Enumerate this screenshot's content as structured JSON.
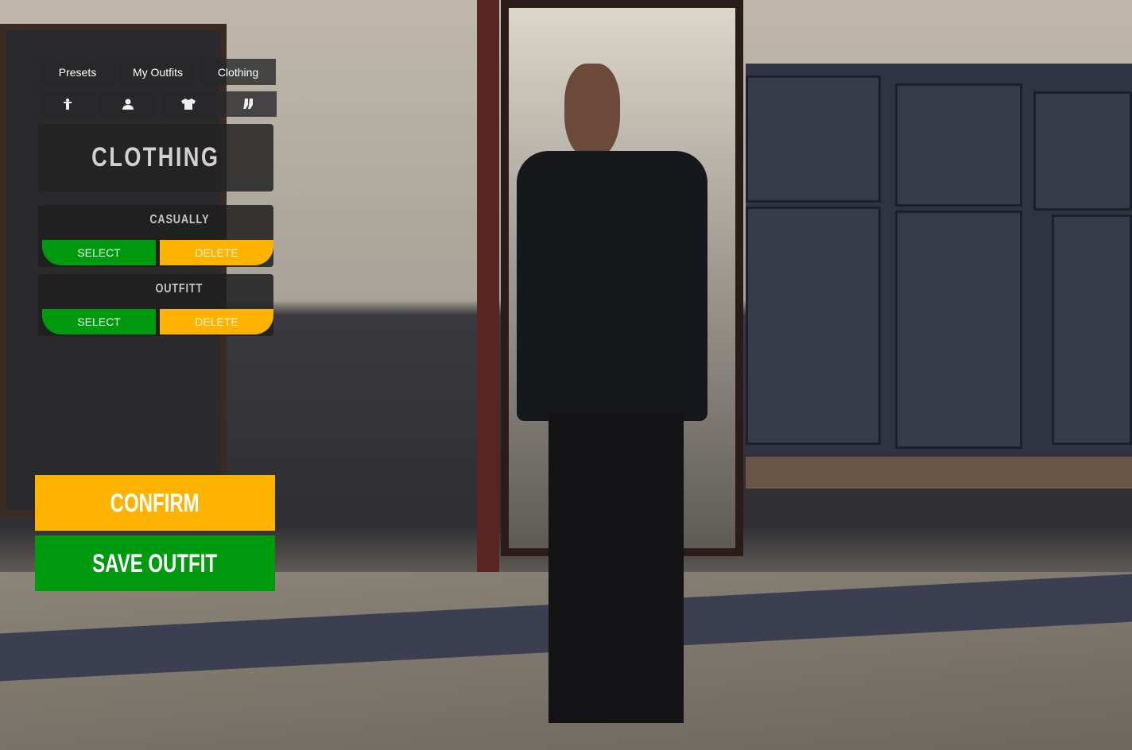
{
  "tabs": [
    {
      "label": "Presets"
    },
    {
      "label": "My Outfits"
    },
    {
      "label": "Clothing"
    }
  ],
  "category_icons": [
    "body-icon",
    "person-icon",
    "shirt-icon",
    "socks-icon"
  ],
  "panel_title": "CLOTHING",
  "outfits": [
    {
      "name": "CASUALLY",
      "select_label": "SELECT",
      "delete_label": "DELETE"
    },
    {
      "name": "OUTFITT",
      "select_label": "SELECT",
      "delete_label": "DELETE"
    }
  ],
  "confirm_label": "CONFIRM",
  "save_label": "SAVE OUTFIT",
  "colors": {
    "green": "#009a0e",
    "yellow": "#fdb300",
    "panel": "#232325"
  }
}
